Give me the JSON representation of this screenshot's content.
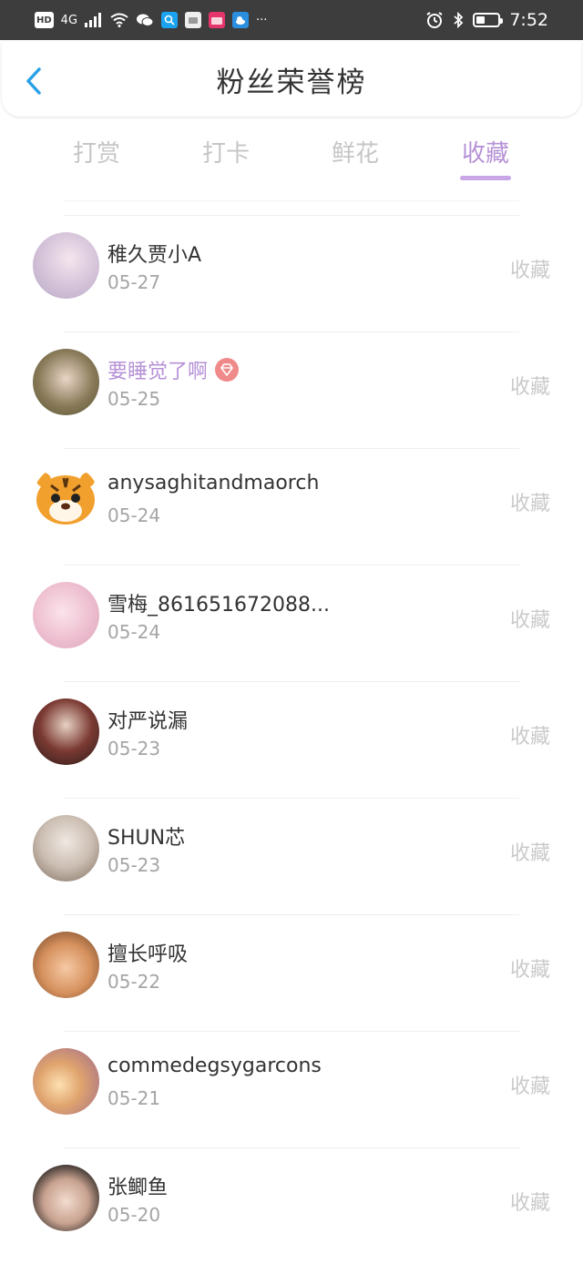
{
  "status_bar": {
    "left_items": [
      "HD",
      "4G"
    ],
    "time": "7:52",
    "more": "···",
    "battery_level": 0.4,
    "icons": [
      "signal-icon",
      "wifi-icon",
      "wechat-icon",
      "search-app-icon",
      "huawei-app-icon",
      "shop-app-icon",
      "weather-app-icon",
      "alarm-icon",
      "bluetooth-icon",
      "battery-icon"
    ]
  },
  "header": {
    "title": "粉丝荣誉榜",
    "back_icon": "chevron-left-icon",
    "back_color": "#2aa0e6"
  },
  "tabs": [
    {
      "label": "打赏",
      "active": false
    },
    {
      "label": "打卡",
      "active": false
    },
    {
      "label": "鲜花",
      "active": false
    },
    {
      "label": "收藏",
      "active": true
    }
  ],
  "accent_color": "#b691d6",
  "fans": [
    {
      "name": "稚久贾小A",
      "date": "05-27",
      "action": "收藏",
      "vip": false
    },
    {
      "name": "要睡觉了啊",
      "date": "05-25",
      "action": "收藏",
      "vip": true,
      "badge_icon": "diamond-badge-icon"
    },
    {
      "name": "anysaghitandmaorch",
      "date": "05-24",
      "action": "收藏",
      "vip": false
    },
    {
      "name": "雪梅_861651672088...",
      "date": "05-24",
      "action": "收藏",
      "vip": false
    },
    {
      "name": "对严说漏",
      "date": "05-23",
      "action": "收藏",
      "vip": false
    },
    {
      "name": "SHUN芯",
      "date": "05-23",
      "action": "收藏",
      "vip": false
    },
    {
      "name": "擅长呼吸",
      "date": "05-22",
      "action": "收藏",
      "vip": false
    },
    {
      "name": "commedegsygarcons",
      "date": "05-21",
      "action": "收藏",
      "vip": false
    },
    {
      "name": "张鲫鱼",
      "date": "05-20",
      "action": "收藏",
      "vip": false
    }
  ]
}
